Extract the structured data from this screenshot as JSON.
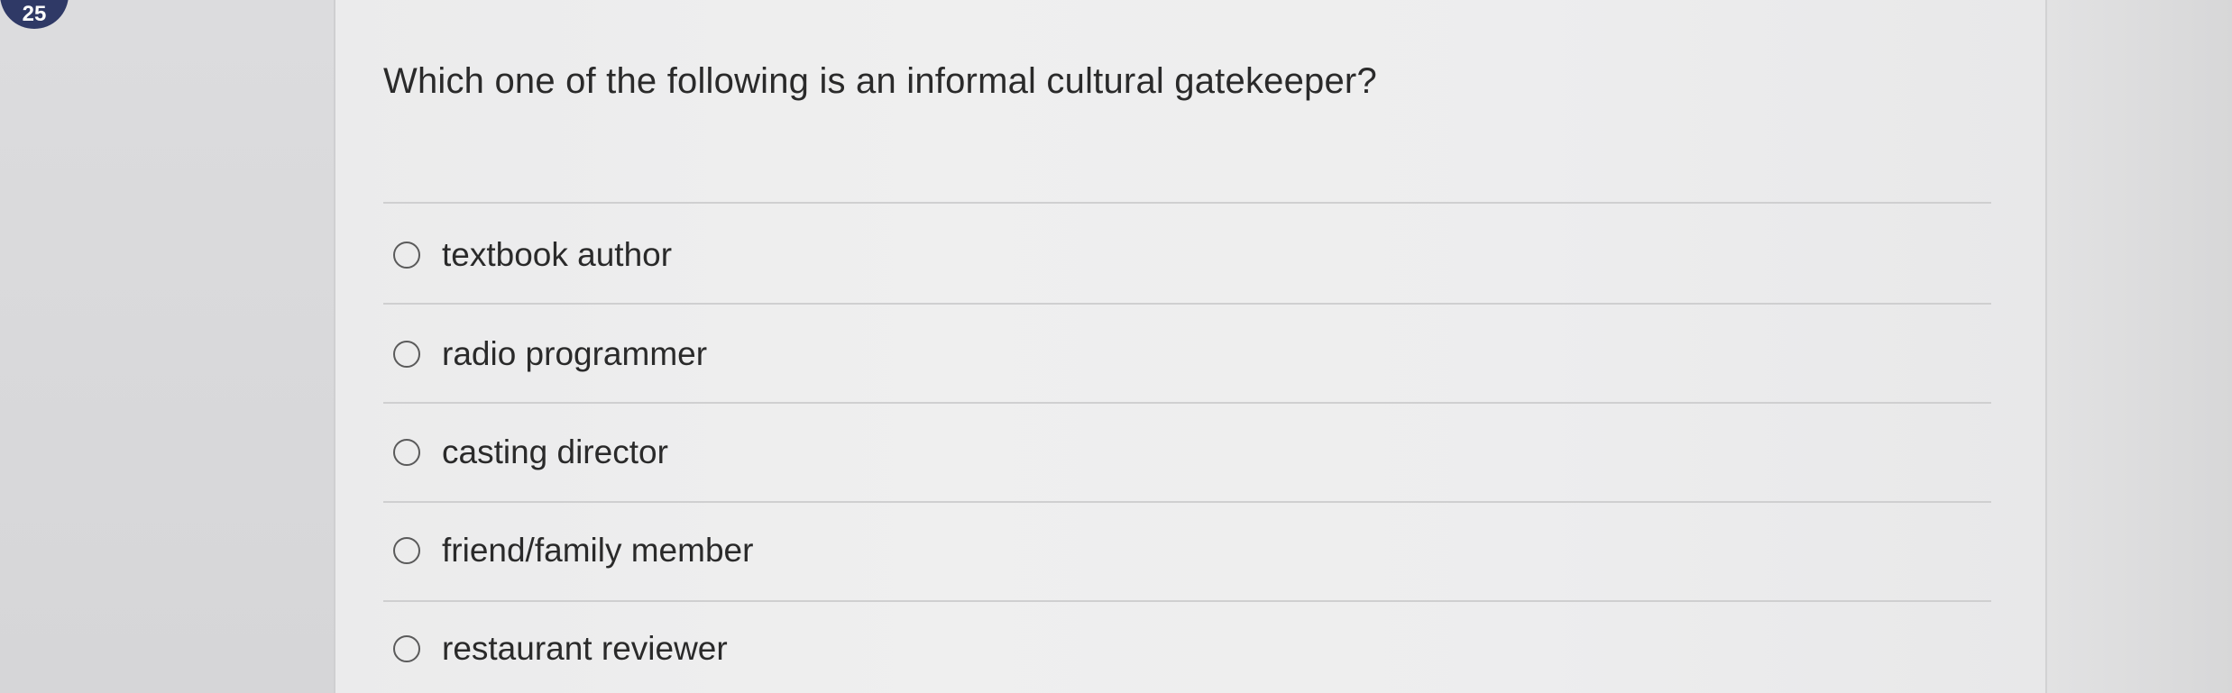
{
  "question_number": "25",
  "question": {
    "text": "Which one of the following is an informal cultural gatekeeper?"
  },
  "options": [
    {
      "label": "textbook author",
      "selected": false
    },
    {
      "label": "radio programmer",
      "selected": false
    },
    {
      "label": "casting director",
      "selected": false
    },
    {
      "label": "friend/family member",
      "selected": false
    },
    {
      "label": "restaurant reviewer",
      "selected": false
    }
  ],
  "colors": {
    "badge_background": "#2f3966",
    "text": "#2a2a2a",
    "divider": "#cfcfd0"
  }
}
